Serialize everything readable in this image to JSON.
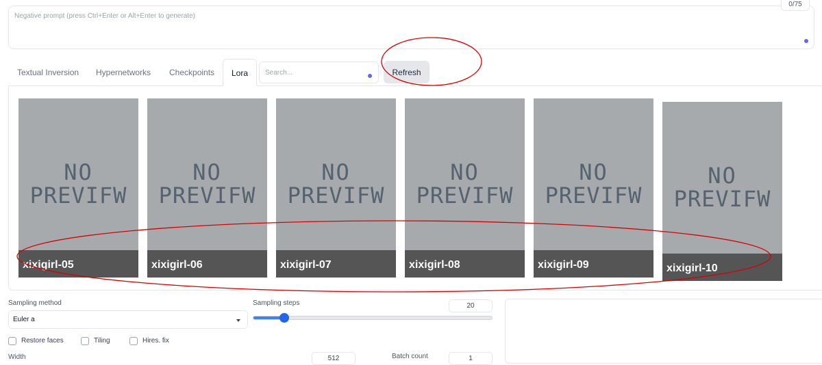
{
  "negative_prompt": {
    "placeholder": "Negative prompt (press Ctrl+Enter or Alt+Enter to generate)",
    "token_count": "0/75"
  },
  "tabs": [
    {
      "label": "Textual Inversion",
      "active": false
    },
    {
      "label": "Hypernetworks",
      "active": false
    },
    {
      "label": "Checkpoints",
      "active": false
    },
    {
      "label": "Lora",
      "active": true
    }
  ],
  "search": {
    "placeholder": "Search..."
  },
  "refresh_label": "Refresh",
  "cards": [
    {
      "name": "xixigirl-05",
      "preview_line1": "NO",
      "preview_line2": "PREVIFW"
    },
    {
      "name": "xixigirl-06",
      "preview_line1": "NO",
      "preview_line2": "PREVIFW"
    },
    {
      "name": "xixigirl-07",
      "preview_line1": "NO",
      "preview_line2": "PREVIFW"
    },
    {
      "name": "xixigirl-08",
      "preview_line1": "NO",
      "preview_line2": "PREVIFW"
    },
    {
      "name": "xixigirl-09",
      "preview_line1": "NO",
      "preview_line2": "PREVIFW"
    },
    {
      "name": "xixigirl-10",
      "preview_line1": "NO",
      "preview_line2": "PREVIFW"
    }
  ],
  "sampling_method": {
    "label": "Sampling method",
    "value": "Euler a"
  },
  "sampling_steps": {
    "label": "Sampling steps",
    "value": "20",
    "fraction": 0.13
  },
  "checkboxes": [
    {
      "label": "Restore faces",
      "checked": false
    },
    {
      "label": "Tiling",
      "checked": false
    },
    {
      "label": "Hires. fix",
      "checked": false
    }
  ],
  "width": {
    "label": "Width",
    "value": "512"
  },
  "batch_count": {
    "label": "Batch count",
    "value": "1"
  },
  "colors": {
    "accent": "#6366f1",
    "slider": "#2563eb",
    "annotation": "#d90000",
    "card_bg": "#a7aaac",
    "card_footer": "#555555"
  }
}
